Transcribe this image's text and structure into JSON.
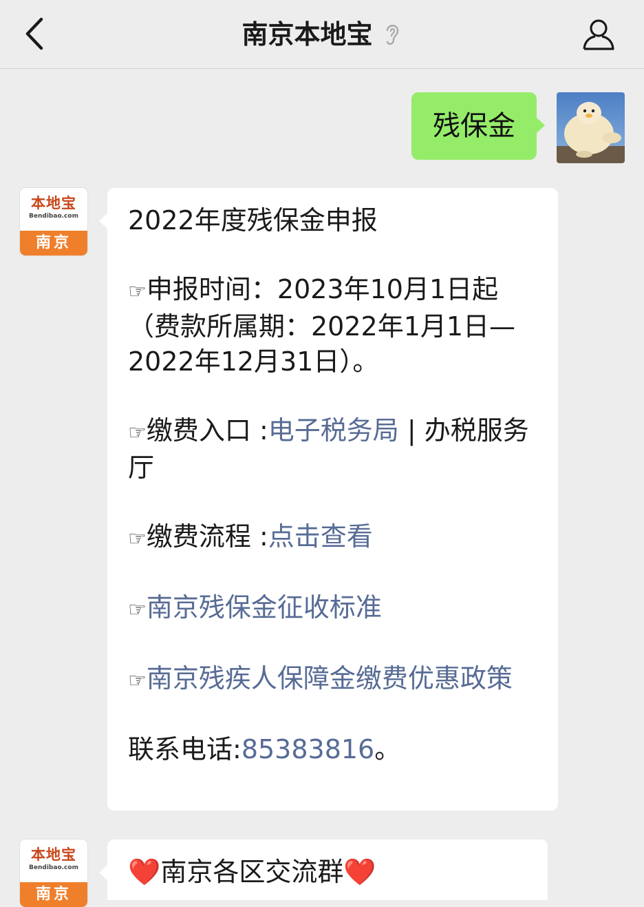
{
  "header": {
    "title": "南京本地宝"
  },
  "sent_message": {
    "text": "残保金"
  },
  "bot": {
    "brand": "本地宝",
    "brand_url": "Bendibao.com",
    "city": "南京"
  },
  "reply": {
    "heading": "2022年度残保金申报",
    "hand": "☞",
    "time_label": "申报时间：",
    "time_value": "2023年10月1日起（费款所属期：2022年1月1日—2022年12月31日）。",
    "pay_entry_label": "缴费入口 :",
    "pay_entry_link": "电子税务局",
    "pay_entry_rest": " | 办税服务厅",
    "pay_flow_label": "缴费流程 :",
    "pay_flow_link": "点击查看",
    "link_standard": "南京残保金征收标准",
    "link_policy": "南京残疾人保障金缴费优惠政策",
    "contact_label": "联系电话:",
    "contact_phone": "85383816",
    "contact_end": "。"
  },
  "second_reply": {
    "heart": "❤️",
    "text": "南京各区交流群"
  }
}
